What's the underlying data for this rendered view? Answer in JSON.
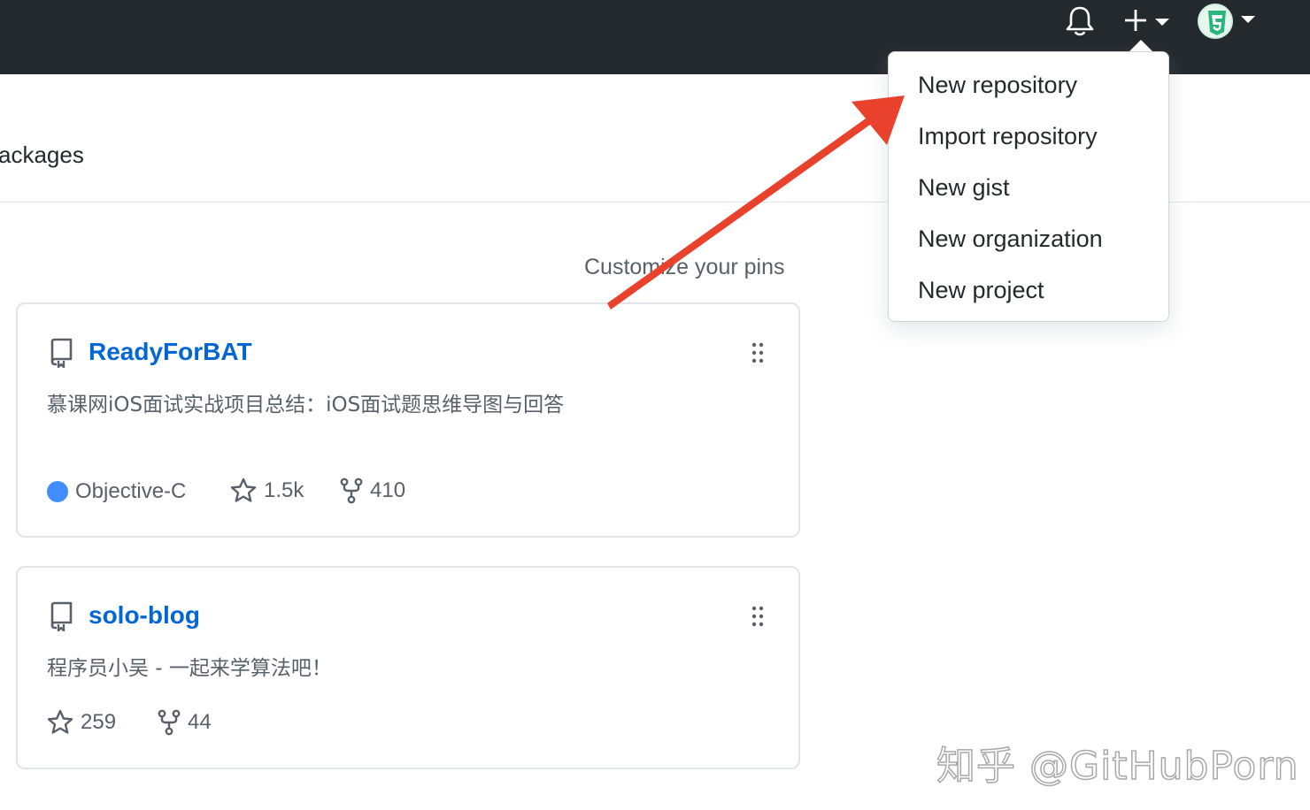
{
  "header": {
    "notification_icon": "bell-icon",
    "create_icon": "plus-icon",
    "avatar_icon": "html5-avatar"
  },
  "nav": {
    "tab_label": "ackages"
  },
  "pins": {
    "customize_label": "Customize your pins"
  },
  "repos": [
    {
      "name": "ReadyForBAT",
      "description": "慕课网iOS面试实战项目总结：iOS面试题思维导图与回答",
      "language": "Objective-C",
      "language_color": "#438eff",
      "stars": "1.5k",
      "forks": "410"
    },
    {
      "name": "solo-blog",
      "description": "程序员小吴 - 一起来学算法吧！",
      "stars": "259",
      "forks": "44"
    }
  ],
  "create_menu": {
    "items": [
      "New repository",
      "Import repository",
      "New gist",
      "New organization",
      "New project"
    ]
  },
  "annotation": {
    "arrow_color": "#e8412c"
  },
  "watermark": {
    "text": "知乎 @GitHubPorn"
  }
}
